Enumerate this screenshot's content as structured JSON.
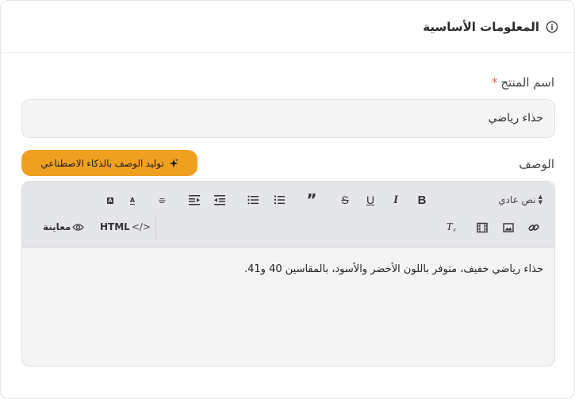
{
  "section": {
    "title": "المعلومات الأساسية"
  },
  "product_name": {
    "label": "اسم المنتج",
    "required_mark": "*",
    "value": "حذاء رياضي"
  },
  "description": {
    "label": "الوصف",
    "ai_button_label": "توليد الوصف بالذكاء الاصطناعي",
    "toolbar": {
      "paragraph_select": "نص عادي",
      "html_label": "HTML",
      "preview_label": "معاينة",
      "small_text_label": "A"
    },
    "content": "حذاء رياضي خفيف، متوفر باللون الأخضر والأسود، بالمقاسين 40 و41."
  },
  "colors": {
    "accent": "#f0a021",
    "toolbar_bg": "#e5e6e9",
    "field_bg": "#f5f5f5",
    "required": "#e05555"
  }
}
